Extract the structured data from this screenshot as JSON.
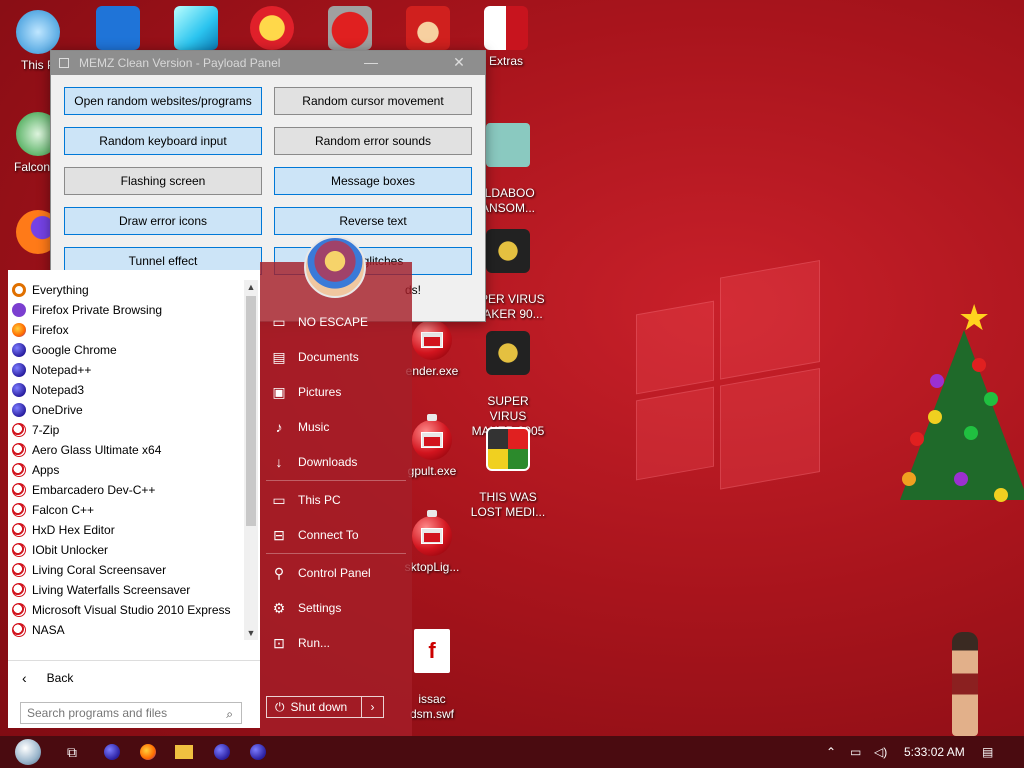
{
  "desktop": {
    "icons_left": [
      {
        "label": "This P"
      },
      {
        "label": "Falcon C"
      }
    ],
    "icons_right": [
      {
        "label": "Extras"
      },
      {
        "label": "ILDABOO\nANSOM..."
      },
      {
        "label": "UPER VIRUS\nMAKER 90..."
      },
      {
        "label": "SUPER VIRUS\nMAKER 9005"
      },
      {
        "label": "THIS WAS\nLOST MEDI..."
      }
    ],
    "icons_mid": [
      {
        "label": "ender.exe"
      },
      {
        "label": "gpult.exe"
      },
      {
        "label": "sktopLig..."
      },
      {
        "label": "issac\ndsm.swf"
      }
    ]
  },
  "memz": {
    "title": "MEMZ Clean Version - Payload Panel",
    "buttons": [
      {
        "label": "Open random websites/programs",
        "active": true
      },
      {
        "label": "Random cursor movement",
        "active": false
      },
      {
        "label": "Random keyboard input",
        "active": true
      },
      {
        "label": "Random error sounds",
        "active": false
      },
      {
        "label": "Flashing screen",
        "active": false
      },
      {
        "label": "Message boxes",
        "active": true
      },
      {
        "label": "Draw error icons",
        "active": true
      },
      {
        "label": "Reverse text",
        "active": true
      },
      {
        "label": "Tunnel effect",
        "active": true
      },
      {
        "label": "...n glitches",
        "active": true
      }
    ],
    "note": "ds!"
  },
  "start_menu": {
    "programs": [
      {
        "label": "Everything",
        "icon": "mag"
      },
      {
        "label": "Firefox Private Browsing",
        "icon": "ffp"
      },
      {
        "label": "Firefox",
        "icon": "ff"
      },
      {
        "label": "Google Chrome",
        "icon": "purple"
      },
      {
        "label": "Notepad++",
        "icon": "purple"
      },
      {
        "label": "Notepad3",
        "icon": "purple"
      },
      {
        "label": "OneDrive",
        "icon": "purple"
      },
      {
        "label": "7-Zip",
        "icon": "orn"
      },
      {
        "label": "Aero Glass Ultimate x64",
        "icon": "orn"
      },
      {
        "label": "Apps",
        "icon": "orn"
      },
      {
        "label": "Embarcadero Dev-C++",
        "icon": "orn"
      },
      {
        "label": "Falcon C++",
        "icon": "orn"
      },
      {
        "label": "HxD Hex Editor",
        "icon": "orn"
      },
      {
        "label": "IObit Unlocker",
        "icon": "orn"
      },
      {
        "label": "Living Coral Screensaver",
        "icon": "orn"
      },
      {
        "label": "Living Waterfalls Screensaver",
        "icon": "orn"
      },
      {
        "label": "Microsoft Visual Studio 2010 Express",
        "icon": "orn"
      },
      {
        "label": "NASA",
        "icon": "orn"
      }
    ],
    "back_label": "Back",
    "search_placeholder": "Search programs and files",
    "right_items": [
      {
        "label": "NO ESCAPE",
        "icon": "folder-icon"
      },
      {
        "label": "Documents",
        "icon": "documents-icon"
      },
      {
        "label": "Pictures",
        "icon": "pictures-icon"
      },
      {
        "label": "Music",
        "icon": "music-icon"
      },
      {
        "label": "Downloads",
        "icon": "downloads-icon"
      },
      {
        "label": "This PC",
        "icon": "computer-icon"
      },
      {
        "label": "Connect To",
        "icon": "connect-icon"
      },
      {
        "label": "Control Panel",
        "icon": "control-panel-icon"
      },
      {
        "label": "Settings",
        "icon": "settings-icon"
      },
      {
        "label": "Run...",
        "icon": "run-icon"
      }
    ],
    "shutdown_label": "Shut down"
  },
  "taskbar": {
    "clock": "5:33:02 AM"
  }
}
